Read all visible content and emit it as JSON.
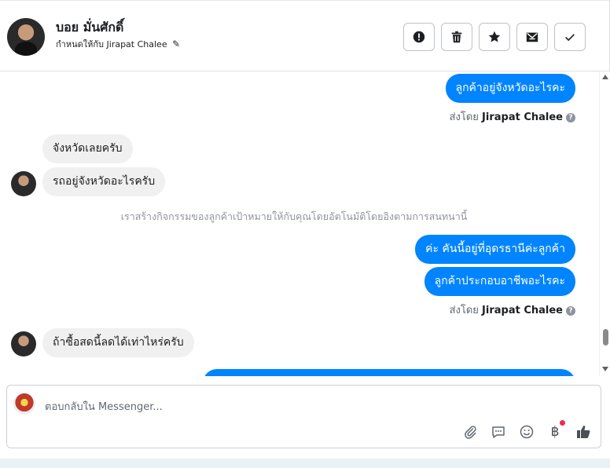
{
  "header": {
    "contact_name": "บอย มั่นศักดิ์",
    "assigned_prefix": "กำหนดให้กับ",
    "assigned_name": "Jirapat Chalee",
    "actions": [
      {
        "icon": "alert-icon",
        "name": "mark-spam-button"
      },
      {
        "icon": "trash-icon",
        "name": "delete-button"
      },
      {
        "icon": "star-icon",
        "name": "star-button"
      },
      {
        "icon": "mark-unread-icon",
        "name": "mark-unread-button"
      },
      {
        "icon": "check-icon",
        "name": "mark-done-button"
      }
    ]
  },
  "thread": {
    "messages": [
      {
        "from": "page",
        "text": "ลูกค้าอยู่จังหวัดอะไรคะ"
      },
      {
        "from": "page_meta",
        "prefix": "ส่งโดย",
        "agent": "Jirapat Chalee",
        "help_icon": "?"
      },
      {
        "from": "customer",
        "text": "จังหวัดเลยครับ"
      },
      {
        "from": "customer",
        "text": "รถอยู่จังหวัดอะไรครับ"
      },
      {
        "from": "system",
        "text": "เราสร้างกิจกรรมของลูกค้าเป้าหมายให้กับคุณโดยอัตโนมัติโดยอิงตามการสนทนานี้"
      },
      {
        "from": "page",
        "text": "ค่ะ คันนี้อยู่ที่อุดรธานีค่ะลูกค้า"
      },
      {
        "from": "page",
        "text": "ลูกค้าประกอบอาชีพอะไรคะ"
      },
      {
        "from": "page_meta",
        "prefix": "ส่งโดย",
        "agent": "Jirapat Chalee",
        "help_icon": "?"
      },
      {
        "from": "customer",
        "text": "ถ้าซื้อสดนี้ลดได้เท่าไหร่ครับ"
      }
    ]
  },
  "composer": {
    "placeholder": "ตอบกลับใน Messenger...",
    "tools": [
      "attach-icon",
      "saved-reply-icon",
      "emoji-icon",
      "currency-icon",
      "like-icon"
    ],
    "currency_symbol": "฿"
  },
  "colors": {
    "outgoing_bubble": "#0084ff",
    "incoming_bubble": "#f0f0f0",
    "notification_dot": "#f02849"
  }
}
